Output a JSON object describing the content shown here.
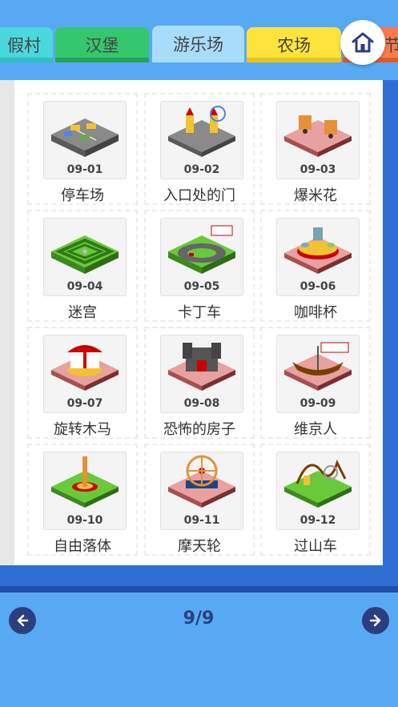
{
  "tabs": [
    {
      "label": "假村"
    },
    {
      "label": "汉堡"
    },
    {
      "label": "游乐场",
      "selected": true
    },
    {
      "label": "农场"
    },
    {
      "label": "节日"
    }
  ],
  "home": {
    "icon": "home-icon"
  },
  "colors": {
    "background": "#58a9f3",
    "book_edge": "#2f6fd4",
    "nav_button": "#2b3f7f"
  },
  "items": [
    {
      "code": "09-01",
      "name": "停车场"
    },
    {
      "code": "09-02",
      "name": "入口处的门"
    },
    {
      "code": "09-03",
      "name": "爆米花"
    },
    {
      "code": "09-04",
      "name": "迷宫"
    },
    {
      "code": "09-05",
      "name": "卡丁车"
    },
    {
      "code": "09-06",
      "name": "咖啡杯"
    },
    {
      "code": "09-07",
      "name": "旋转木马"
    },
    {
      "code": "09-08",
      "name": "恐怖的房子"
    },
    {
      "code": "09-09",
      "name": "维京人"
    },
    {
      "code": "09-10",
      "name": "自由落体"
    },
    {
      "code": "09-11",
      "name": "摩天轮"
    },
    {
      "code": "09-12",
      "name": "过山车"
    }
  ],
  "pagination": {
    "label": "9/9",
    "prev_icon": "arrow-left-icon",
    "next_icon": "arrow-right-icon"
  }
}
